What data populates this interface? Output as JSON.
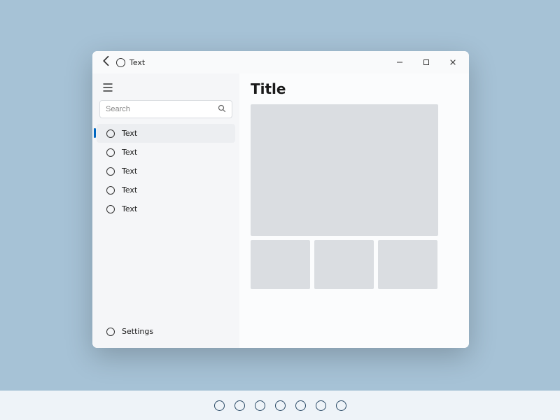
{
  "window": {
    "title": "Text"
  },
  "sidebar": {
    "search_placeholder": "Search",
    "items": [
      {
        "label": "Text",
        "selected": true
      },
      {
        "label": "Text",
        "selected": false
      },
      {
        "label": "Text",
        "selected": false
      },
      {
        "label": "Text",
        "selected": false
      },
      {
        "label": "Text",
        "selected": false
      }
    ],
    "settings_label": "Settings"
  },
  "content": {
    "title": "Title"
  },
  "taskbar": {
    "item_count": 7
  }
}
